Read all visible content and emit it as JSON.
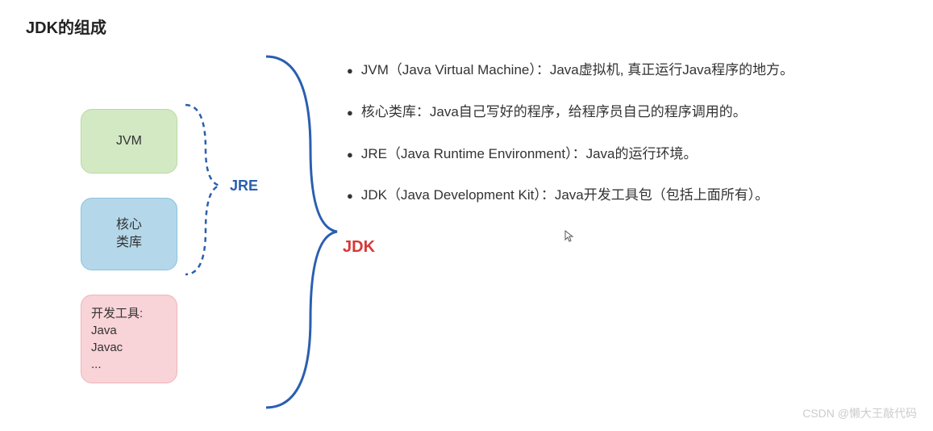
{
  "title": "JDK的组成",
  "boxes": {
    "jvm": "JVM",
    "core": "核心\n类库",
    "dev": "开发工具:\nJava\nJavac\n..."
  },
  "labels": {
    "jre": "JRE",
    "jdk": "JDK"
  },
  "bullets": [
    "JVM（Java Virtual Machine）：Java虚拟机, 真正运行Java程序的地方。",
    "核心类库：Java自己写好的程序，给程序员自己的程序调用的。",
    "JRE（Java Runtime Environment）：Java的运行环境。",
    "JDK（Java Development Kit）：Java开发工具包（包括上面所有）。"
  ],
  "watermark": "CSDN @懒大王敲代码",
  "colors": {
    "jre_bracket": "#2a5fb0",
    "jdk_bracket": "#2a5fb0"
  }
}
